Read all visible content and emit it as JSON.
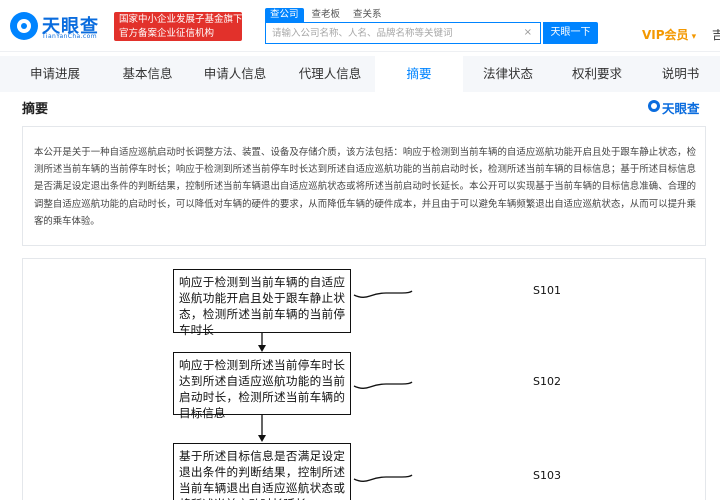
{
  "header": {
    "logo_text": "天眼查",
    "logo_sub": "TianYanCha.com",
    "gov_badge_line1": "国家中小企业发展子基金旗下",
    "gov_badge_line2": "官方备案企业征信机构",
    "search_tabs": [
      "查公司",
      "查老板",
      "查关系"
    ],
    "search_placeholder": "请输入公司名称、人名、品牌名称等关键词",
    "clear_icon": "×",
    "search_button": "天眼一下",
    "vip_label": "VIP会员",
    "vip_caret": "▾",
    "cutoff_char": "吉"
  },
  "nav": {
    "items": [
      "申请进展",
      "基本信息",
      "申请人信息",
      "代理人信息",
      "摘要",
      "法律状态",
      "权利要求",
      "说明书"
    ],
    "active_index": 4
  },
  "section": {
    "title": "摘要",
    "brand": "天眼查"
  },
  "abstract": {
    "text": "本公开是关于一种自适应巡航启动时长调整方法、装置、设备及存储介质，该方法包括：响应于检测到当前车辆的自适应巡航功能开启且处于跟车静止状态，检测所述当前车辆的当前停车时长；响应于检测到所述当前停车时长达到所述自适应巡航功能的当前启动时长，检测所述当前车辆的目标信息；基于所述目标信息是否满足设定退出条件的判断结果，控制所述当前车辆退出自适应巡航状态或将所述当前启动时长延长。本公开可以实现基于当前车辆的目标信息准确、合理的调整自适应巡航功能的启动时长，可以降低对车辆的硬件的要求，从而降低车辆的硬件成本，并且由于可以避免车辆频繁退出自适应巡航状态，从而可以提升乘客的乘车体验。"
  },
  "figure": {
    "steps": [
      {
        "text": "响应于检测到当前车辆的自适应巡航功能开启且处于跟车静止状态，检测所述当前车辆的当前停车时长",
        "label": "S101"
      },
      {
        "text": "响应于检测到所述当前停车时长达到所述自适应巡航功能的当前启动时长，检测所述当前车辆的目标信息",
        "label": "S102"
      },
      {
        "text": "基于所述目标信息是否满足设定退出条件的判断结果，控制所述当前车辆退出自适应巡航状态或将所述当前启动时长延长",
        "label": "S103"
      }
    ]
  },
  "colors": {
    "brand_blue": "#0084ff",
    "logo_blue": "#0a6cde",
    "badge_red": "#e2312b",
    "vip_orange": "#f39800",
    "nav_bg": "#f5f7fa"
  },
  "icons": {
    "logo": "tianyancha-logo-icon",
    "clear": "clear-icon",
    "brand": "tianyancha-small-logo-icon"
  }
}
